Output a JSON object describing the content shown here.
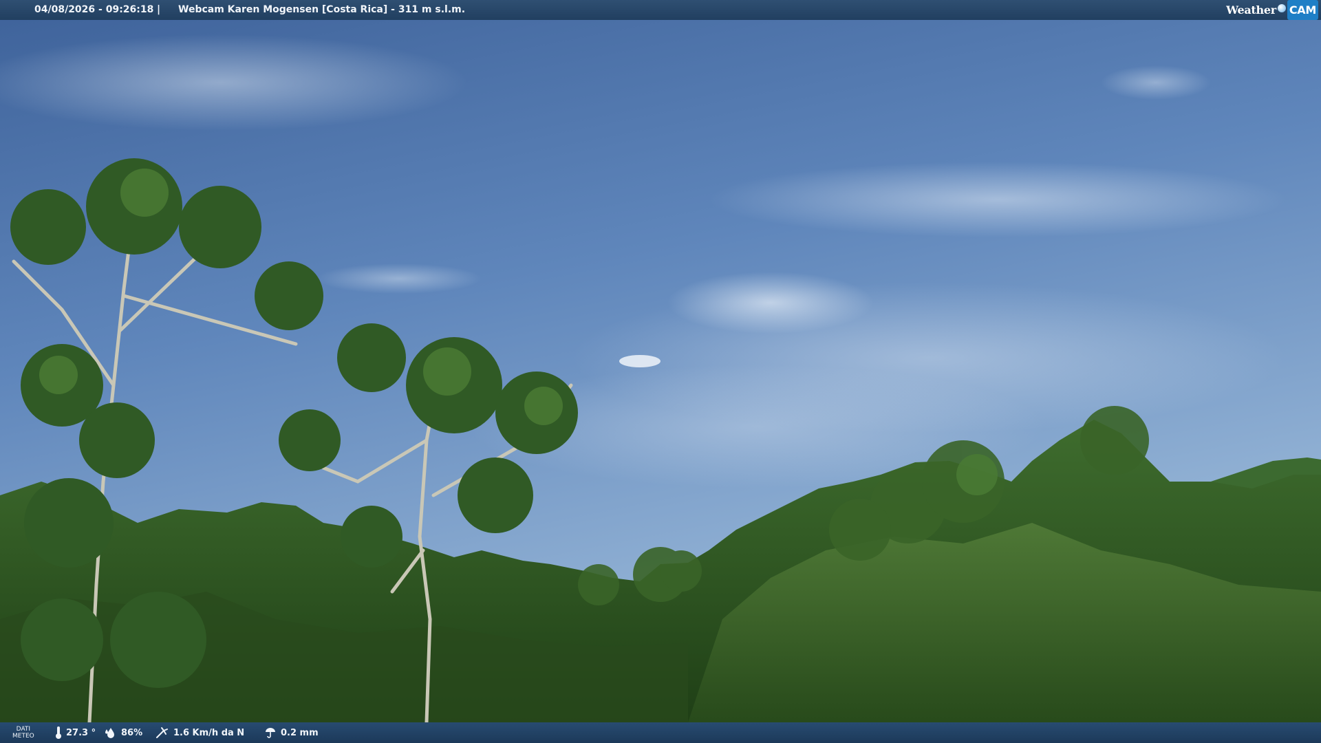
{
  "header": {
    "datetime": "04/08/2026 - 09:26:18",
    "separator": "|",
    "title": "Webcam Karen Mogensen [Costa Rica]  - 311 m s.l.m."
  },
  "logo": {
    "weather": "Weather",
    "cam": "CAM"
  },
  "meteo": {
    "label_line1": "DATI",
    "label_line2": "METEO",
    "temperature": "27.3 °",
    "humidity": "86%",
    "wind": "1.6 Km/h da N",
    "rain": "0.2 mm"
  },
  "icons": {
    "temperature": "thermometer-icon",
    "humidity": "humidity-drop-icon",
    "wind": "wind-icon",
    "rain": "rain-icon"
  },
  "colors": {
    "bar": "#213f60",
    "sky": "#6f93c0",
    "foliage": "#2f5a22"
  }
}
